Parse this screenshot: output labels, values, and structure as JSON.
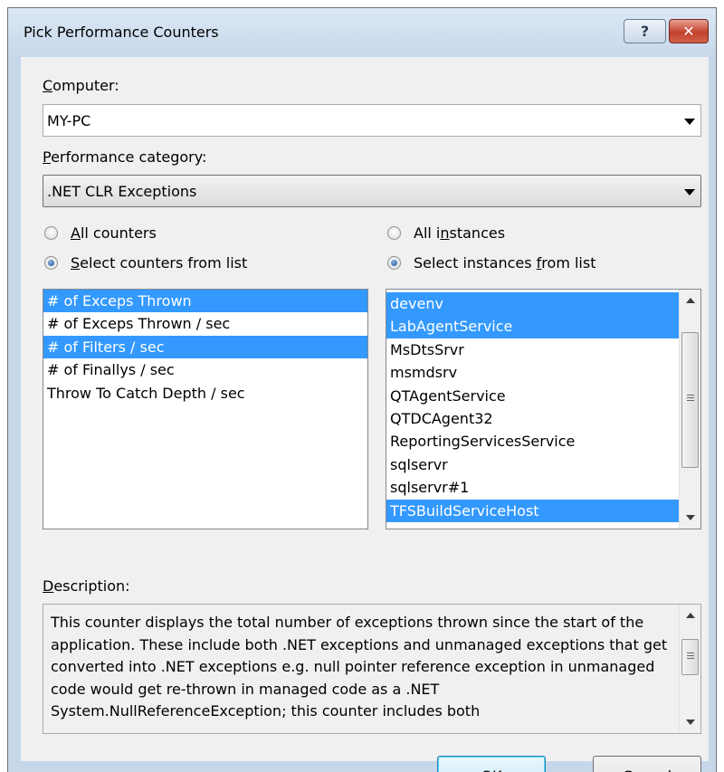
{
  "window": {
    "title": "Pick Performance Counters",
    "help_label": "?",
    "close_label": "✕"
  },
  "computer": {
    "label_u": "C",
    "label_rest": "omputer:",
    "value": "MY-PC"
  },
  "category": {
    "label_u": "P",
    "label_rest": "erformance category:",
    "value": ".NET CLR Exceptions"
  },
  "counters_mode": {
    "all": {
      "label_u": "A",
      "label_rest": "ll counters",
      "checked": false
    },
    "select": {
      "label_u": "S",
      "label_rest": "elect counters from list",
      "checked": true
    }
  },
  "instances_mode": {
    "all": {
      "label_pre": "All i",
      "label_u": "n",
      "label_rest": "stances",
      "checked": false
    },
    "select": {
      "label_pre": "Select instances ",
      "label_u": "f",
      "label_rest": "rom list",
      "checked": true
    }
  },
  "counters": [
    {
      "label": "# of Exceps Thrown",
      "selected": true
    },
    {
      "label": "# of Exceps Thrown / sec",
      "selected": false
    },
    {
      "label": "# of Filters / sec",
      "selected": true
    },
    {
      "label": "# of Finallys / sec",
      "selected": false
    },
    {
      "label": "Throw To Catch Depth / sec",
      "selected": false
    }
  ],
  "instances": [
    {
      "label": "devenv",
      "selected": true
    },
    {
      "label": "LabAgentService",
      "selected": true
    },
    {
      "label": "MsDtsSrvr",
      "selected": false
    },
    {
      "label": "msmdsrv",
      "selected": false
    },
    {
      "label": "QTAgentService",
      "selected": false
    },
    {
      "label": "QTDCAgent32",
      "selected": false
    },
    {
      "label": "ReportingServicesService",
      "selected": false
    },
    {
      "label": "sqlservr",
      "selected": false
    },
    {
      "label": "sqlservr#1",
      "selected": false
    },
    {
      "label": "TFSBuildServiceHost",
      "selected": true
    }
  ],
  "description": {
    "label_u": "D",
    "label_rest": "escription:",
    "text": "This counter displays the total number of exceptions thrown since the start of the application. These include both .NET exceptions and unmanaged exceptions that get converted into .NET exceptions e.g. null pointer reference exception in unmanaged code would get re-thrown in managed code as a .NET System.NullReferenceException; this counter includes both"
  },
  "buttons": {
    "ok": "OK",
    "cancel": "Cancel"
  },
  "colors": {
    "selection": "#3399ff",
    "titlebar": "#c7d8eb",
    "close": "#c2412b"
  }
}
